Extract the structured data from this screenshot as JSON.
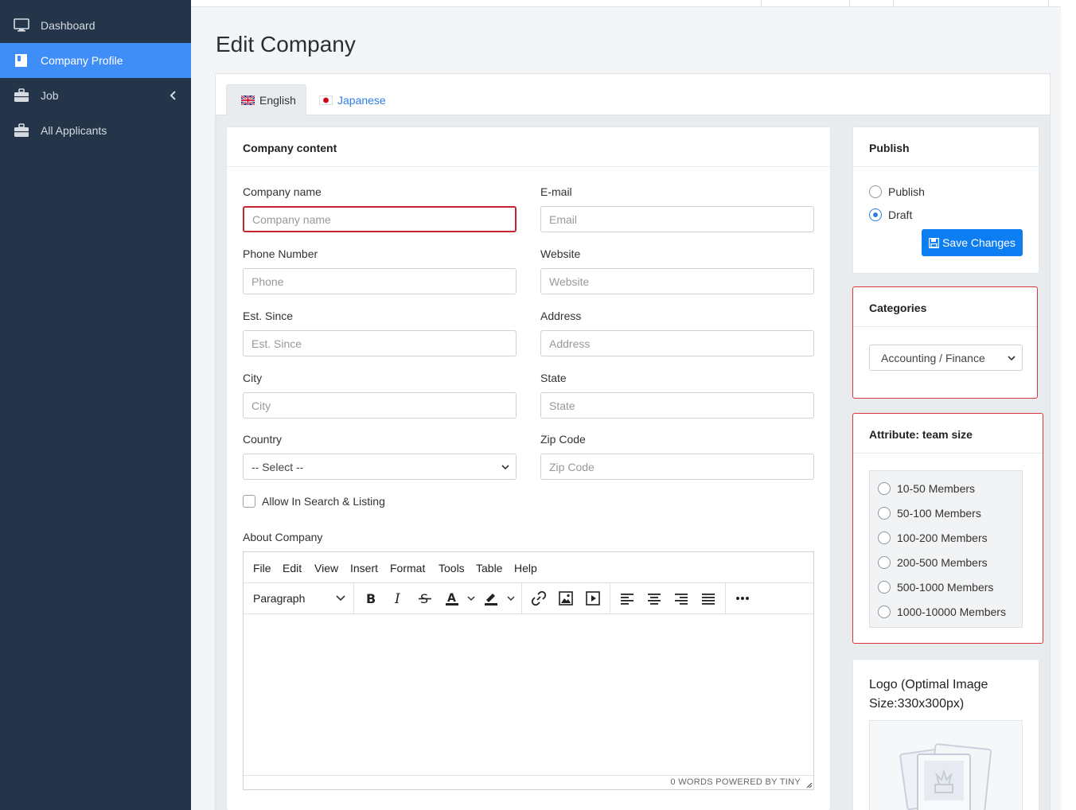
{
  "sidebar": {
    "items": [
      {
        "label": "Dashboard",
        "icon": "monitor-icon"
      },
      {
        "label": "Company Profile",
        "icon": "book-icon"
      },
      {
        "label": "Job",
        "icon": "briefcase-icon"
      },
      {
        "label": "All Applicants",
        "icon": "briefcase-icon"
      }
    ],
    "active_color": "#3f8ef7",
    "bg_color": "#243449"
  },
  "page": {
    "title": "Edit Company"
  },
  "tabs": [
    {
      "label": "English",
      "flag": "uk-flag-icon"
    },
    {
      "label": "Japanese",
      "flag": "japan-flag-icon"
    }
  ],
  "company_content": {
    "header": "Company content",
    "fields": {
      "company_name": {
        "label": "Company name",
        "placeholder": "Company name"
      },
      "email": {
        "label": "E-mail",
        "placeholder": "Email"
      },
      "phone": {
        "label": "Phone Number",
        "placeholder": "Phone"
      },
      "website": {
        "label": "Website",
        "placeholder": "Website"
      },
      "est_since": {
        "label": "Est. Since",
        "placeholder": "Est. Since"
      },
      "address": {
        "label": "Address",
        "placeholder": "Address"
      },
      "city": {
        "label": "City",
        "placeholder": "City"
      },
      "state": {
        "label": "State",
        "placeholder": "State"
      },
      "country": {
        "label": "Country",
        "value": "-- Select --"
      },
      "zip": {
        "label": "Zip Code",
        "placeholder": "Zip Code"
      }
    },
    "allow_search_label": "Allow In Search & Listing",
    "about_label": "About Company",
    "editor": {
      "menus": [
        "File",
        "Edit",
        "View",
        "Insert",
        "Format",
        "Tools",
        "Table",
        "Help"
      ],
      "block_format": "Paragraph",
      "status": "0 WORDS  POWERED BY TINY"
    }
  },
  "publish": {
    "header": "Publish",
    "options": [
      "Publish",
      "Draft"
    ],
    "selected": "Draft",
    "save_label": "Save Changes"
  },
  "categories": {
    "header": "Categories",
    "selected": "Accounting / Finance"
  },
  "team_size": {
    "header": "Attribute: team size",
    "options": [
      "10-50 Members",
      "50-100 Members",
      "100-200 Members",
      "200-500 Members",
      "500-1000 Members",
      "1000-10000 Members"
    ]
  },
  "logo": {
    "header": "Logo (Optimal Image Size:330x300px)"
  }
}
